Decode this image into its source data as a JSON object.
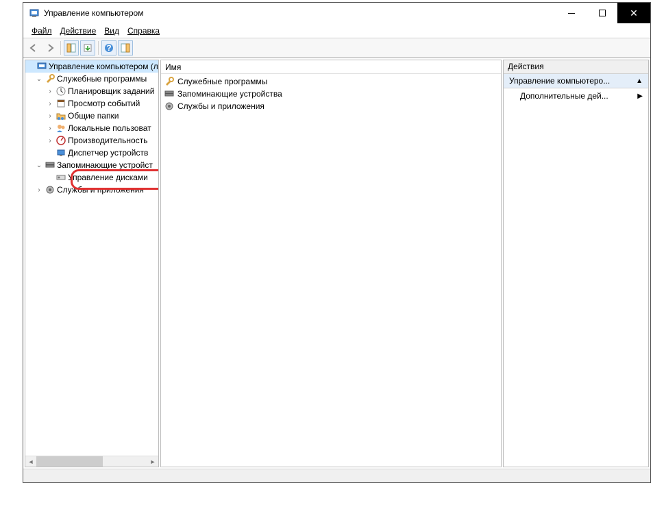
{
  "window": {
    "title": "Управление компьютером"
  },
  "menu": {
    "file": "Файл",
    "action": "Действие",
    "view": "Вид",
    "help": "Справка"
  },
  "tree": {
    "root": "Управление компьютером (л",
    "system_tools": "Служебные программы",
    "task_scheduler": "Планировщик заданий",
    "event_viewer": "Просмотр событий",
    "shared_folders": "Общие папки",
    "local_users": "Локальные пользоват",
    "performance": "Производительность",
    "device_manager": "Диспетчер устройств",
    "storage": "Запоминающие устройст",
    "disk_management": "Управление дисками",
    "services_apps": "Службы и приложения"
  },
  "list": {
    "header_name": "Имя",
    "items": [
      "Служебные программы",
      "Запоминающие устройства",
      "Службы и приложения"
    ]
  },
  "actions": {
    "header": "Действия",
    "section": "Управление компьютеро...",
    "more": "Дополнительные дей..."
  }
}
